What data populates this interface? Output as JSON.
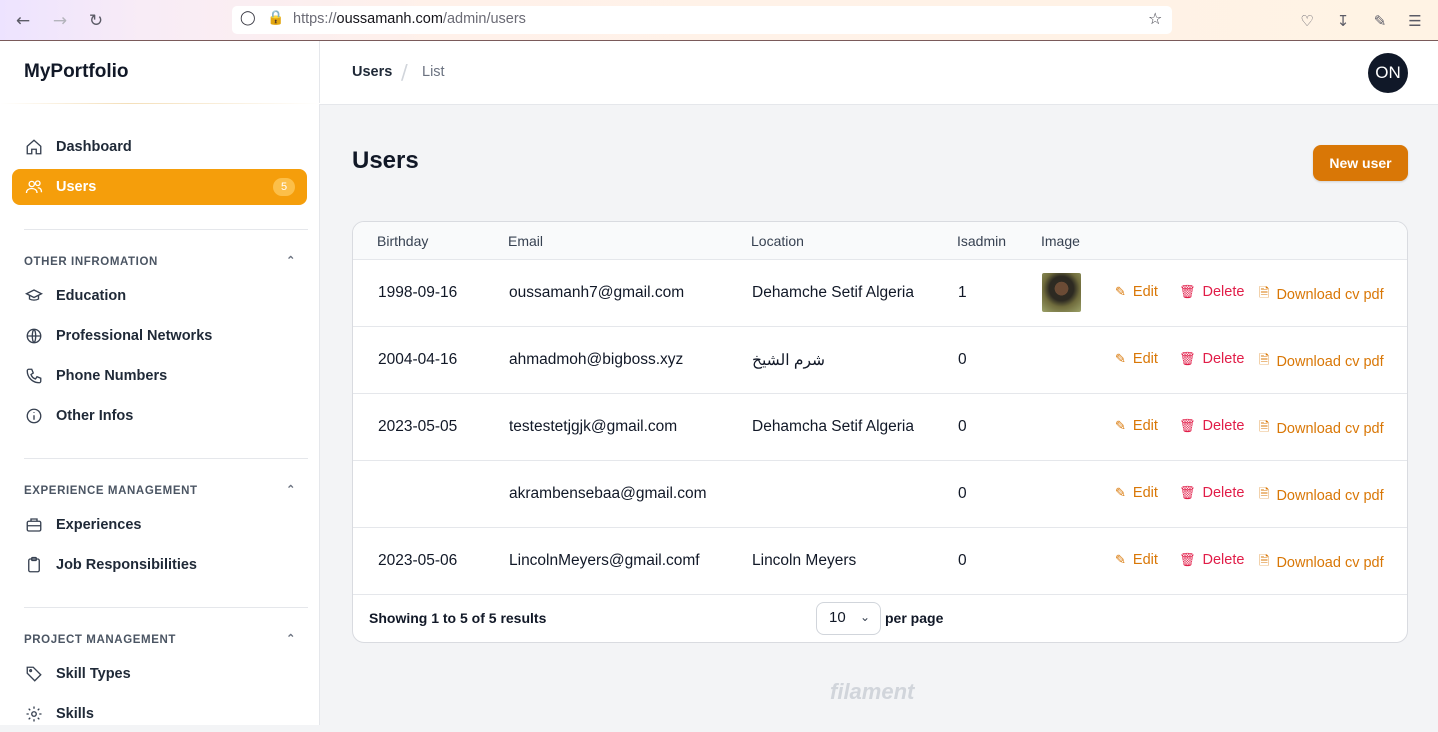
{
  "browser": {
    "url_prefix": "https://",
    "url_domain": "oussamanh.com",
    "url_path": "/admin/users"
  },
  "sidebar": {
    "brand": "MyPortfolio",
    "items": [
      {
        "label": "Dashboard",
        "icon": "home-icon"
      },
      {
        "label": "Users",
        "icon": "users-icon",
        "badge": "5",
        "active": true
      }
    ],
    "groups": [
      {
        "title": "OTHER INFROMATION",
        "items": [
          {
            "label": "Education",
            "icon": "graduation-cap-icon"
          },
          {
            "label": "Professional Networks",
            "icon": "globe-icon"
          },
          {
            "label": "Phone Numbers",
            "icon": "phone-icon"
          },
          {
            "label": "Other Infos",
            "icon": "info-icon"
          }
        ]
      },
      {
        "title": "EXPERIENCE MANAGEMENT",
        "items": [
          {
            "label": "Experiences",
            "icon": "briefcase-icon"
          },
          {
            "label": "Job Responsibilities",
            "icon": "clipboard-icon"
          }
        ]
      },
      {
        "title": "PROJECT MANAGEMENT",
        "items": [
          {
            "label": "Skill Types",
            "icon": "tag-icon"
          },
          {
            "label": "Skills",
            "icon": "gear-icon"
          }
        ]
      }
    ]
  },
  "topbar": {
    "breadcrumb": [
      "Users",
      "List"
    ],
    "avatar_initials": "ON"
  },
  "page": {
    "title": "Users",
    "new_button": "New user"
  },
  "table": {
    "columns": [
      "Birthday",
      "Email",
      "Location",
      "Isadmin",
      "Image"
    ],
    "rows": [
      {
        "birthday": "1998-09-16",
        "email": "oussamanh7@gmail.com",
        "location": "Dehamche Setif Algeria",
        "isadmin": "1",
        "has_image": true
      },
      {
        "birthday": "2004-04-16",
        "email": "ahmadmoh@bigboss.xyz",
        "location": "شرم الشيخ",
        "isadmin": "0",
        "has_image": false
      },
      {
        "birthday": "2023-05-05",
        "email": "testestetjgjk@gmail.com",
        "location": "Dehamcha Setif Algeria",
        "isadmin": "0",
        "has_image": false
      },
      {
        "birthday": "",
        "email": "akrambensebaa@gmail.com",
        "location": "",
        "isadmin": "0",
        "has_image": false
      },
      {
        "birthday": "2023-05-06",
        "email": "LincolnMeyers@gmail.comf",
        "location": "Lincoln Meyers",
        "isadmin": "0",
        "has_image": false
      }
    ],
    "actions": {
      "edit": "Edit",
      "delete": "Delete",
      "download": "Download cv pdf"
    },
    "footer": {
      "showing": "Showing 1 to 5 of 5 results",
      "per_page_value": "10",
      "per_page_label": "per page"
    }
  },
  "footer_brand": "filament",
  "colors": {
    "accent": "#f59e0b",
    "button": "#d97706",
    "danger": "#e11d48"
  }
}
